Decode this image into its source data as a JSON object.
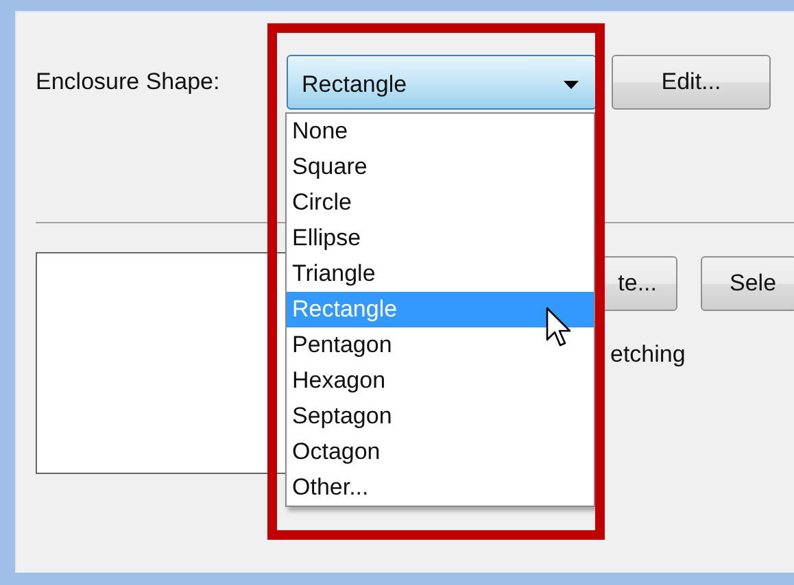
{
  "form": {
    "label": "Enclosure Shape:",
    "combo": {
      "value": "Rectangle",
      "expanded": true
    },
    "edit_button": "Edit...",
    "options": [
      {
        "label": "None",
        "selected": false
      },
      {
        "label": "Square",
        "selected": false
      },
      {
        "label": "Circle",
        "selected": false
      },
      {
        "label": "Ellipse",
        "selected": false
      },
      {
        "label": "Triangle",
        "selected": false
      },
      {
        "label": "Rectangle",
        "selected": true
      },
      {
        "label": "Pentagon",
        "selected": false
      },
      {
        "label": "Hexagon",
        "selected": false
      },
      {
        "label": "Septagon",
        "selected": false
      },
      {
        "label": "Octagon",
        "selected": false
      },
      {
        "label": "Other...",
        "selected": false
      }
    ],
    "lower": {
      "button_1": "te...",
      "button_2": "Sele",
      "text_1": "etching"
    }
  }
}
